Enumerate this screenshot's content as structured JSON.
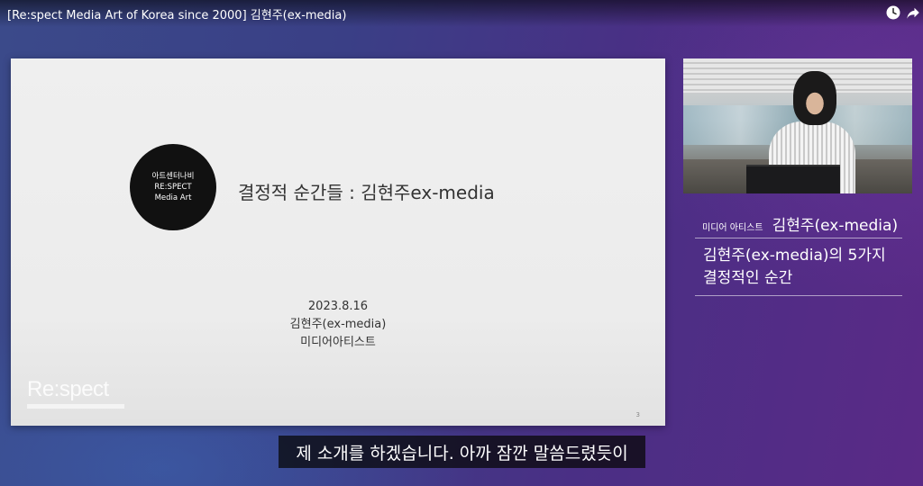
{
  "window": {
    "title": "[Re:spect Media Art of Korea since 2000] 김현주(ex-media)"
  },
  "toolbar": {
    "watch_later_icon": "clock-icon",
    "share_icon": "share-arrow-icon"
  },
  "slide": {
    "logo_lines": [
      "아트센터나비",
      "RE:SPECT",
      "Media Art"
    ],
    "title": "결정적 순간들 : 김현주ex-media",
    "date": "2023.8.16",
    "presenter": "김현주(ex-media)",
    "presenter_role": "미디어아티스트",
    "watermark": "Re:spect",
    "page_number": "3"
  },
  "lower_third": {
    "role": "미디어 아티스트",
    "name": "김현주(ex-media)",
    "description_lines": [
      "김현주(ex-media)의 5가지",
      "결정적인 순간"
    ]
  },
  "caption": {
    "text": "제 소개를 하겠습니다. 아까 잠깐 말씀드렸듯이"
  }
}
